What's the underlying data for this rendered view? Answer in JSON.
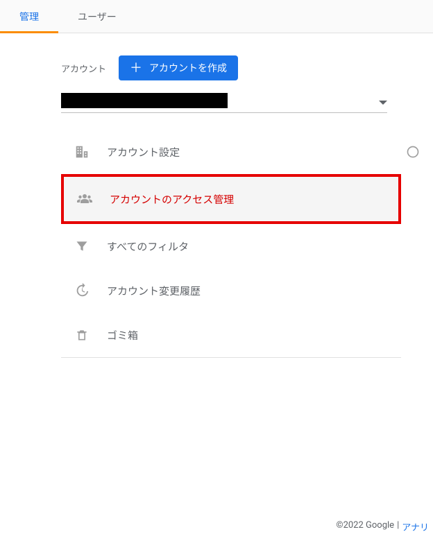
{
  "tabs": {
    "admin": "管理",
    "user": "ユーザー"
  },
  "account": {
    "label": "アカウント",
    "create_button": "アカウントを作成"
  },
  "menu": {
    "settings": "アカウント設定",
    "access": "アカウントのアクセス管理",
    "filters": "すべてのフィルタ",
    "history": "アカウント変更履歴",
    "trash": "ゴミ箱"
  },
  "footer": {
    "copyright": "©2022 Google",
    "separator": "|",
    "link": "アナリ"
  }
}
